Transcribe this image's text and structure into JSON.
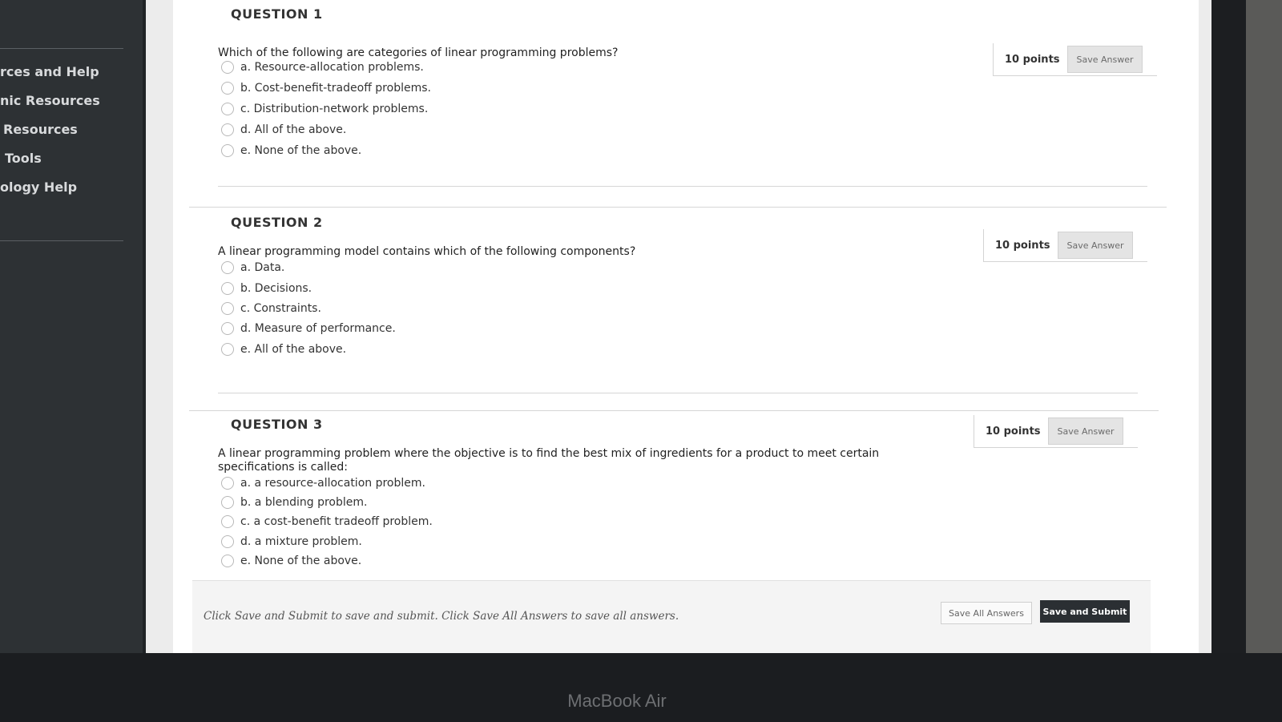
{
  "sidebar": {
    "items": [
      {
        "label": "rces and Help"
      },
      {
        "label": "nic Resources"
      },
      {
        "label": "Resources"
      },
      {
        "label": "Tools"
      },
      {
        "label": "ology Help"
      }
    ]
  },
  "questions": [
    {
      "title": "QUESTION 1",
      "text": "Which of the following are categories of linear programming problems?",
      "points": "10 points",
      "save_label": "Save Answer",
      "options": [
        "a. Resource-allocation problems.",
        "b. Cost-benefit-tradeoff problems.",
        "c. Distribution-network problems.",
        "d. All of the above.",
        "e. None of the above."
      ]
    },
    {
      "title": "QUESTION 2",
      "text": "A linear programming model contains which of the following components?",
      "points": "10 points",
      "save_label": "Save Answer",
      "options": [
        "a. Data.",
        "b. Decisions.",
        "c. Constraints.",
        "d. Measure of performance.",
        "e. All of the above."
      ]
    },
    {
      "title": "QUESTION 3",
      "text": "A linear programming problem where the objective is to find the best mix of ingredients for a product to meet certain specifications is called:",
      "points": "10 points",
      "save_label": "Save Answer",
      "options": [
        "a. a resource-allocation problem.",
        "b. a blending problem.",
        "c. a cost-benefit tradeoff problem.",
        "d. a mixture problem.",
        "e. None of the above."
      ]
    }
  ],
  "footer": {
    "instructions": "Click Save and Submit to save and submit. Click Save All Answers to save all answers.",
    "save_all_label": "Save All Answers",
    "save_submit_label": "Save and Submit"
  },
  "device": {
    "label": "MacBook Air"
  }
}
